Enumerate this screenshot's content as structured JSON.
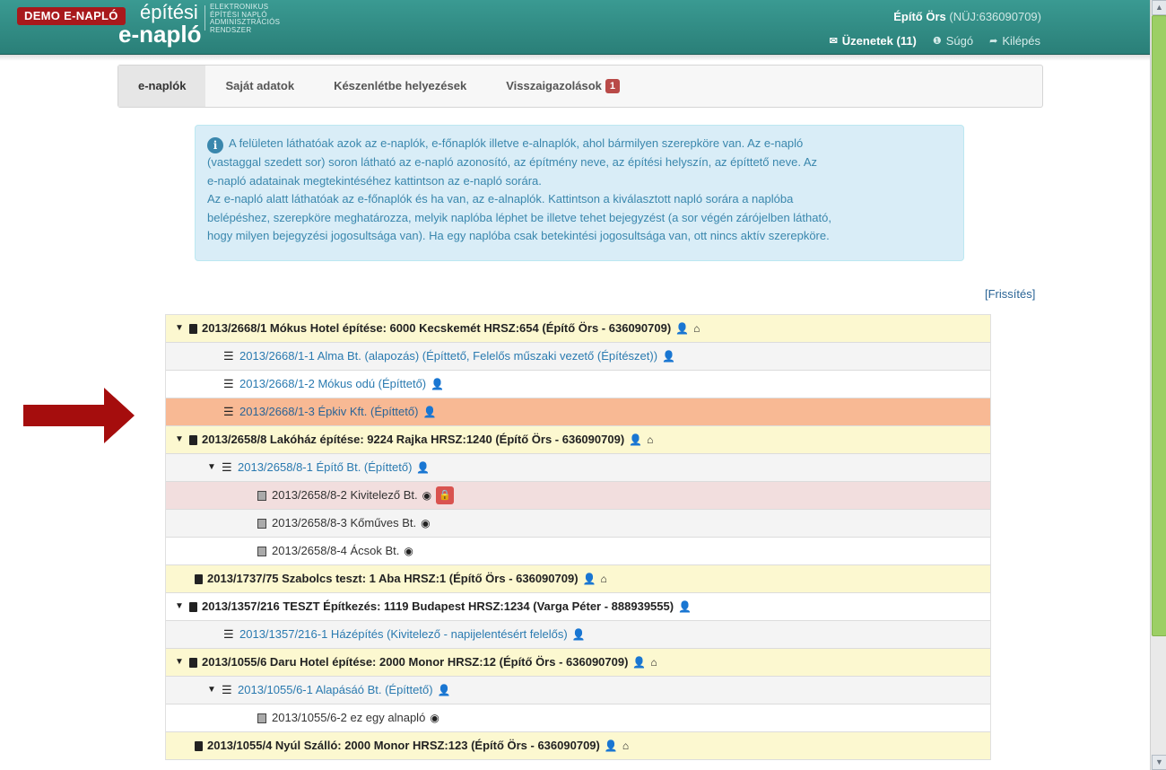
{
  "header": {
    "demo_badge": "DEMO E-NAPLÓ",
    "logo_line1": "építési",
    "logo_line2": "e-napló",
    "logo_small": [
      "ELEKTRONIKUS",
      "ÉPÍTÉSI NAPLÓ",
      "ADMINISZTRÁCIÓS",
      "RENDSZER"
    ],
    "user_name": "Építő Örs",
    "user_id": "(NÜJ:636090709)",
    "messages": "Üzenetek (11)",
    "help": "Súgó",
    "logout": "Kilépés"
  },
  "tabs": [
    {
      "label": "e-naplók"
    },
    {
      "label": "Saját adatok"
    },
    {
      "label": "Készenlétbe helyezések"
    },
    {
      "label": "Visszaigazolások",
      "badge": "1"
    }
  ],
  "info_lines": [
    "A felületen láthatóak azok az e-naplók, e-főnaplók illetve e-alnaplók, ahol bármilyen szerepköre van. Az e-napló",
    "(vastaggal szedett sor) soron látható az e-napló azonosító, az építmény neve, az építési helyszín, az építtető neve. Az",
    "e-napló adatainak megtekintéséhez kattintson az e-napló sorára.",
    "Az e-napló alatt láthatóak az e-főnaplók és ha van, az e-alnaplók. Kattintson a kiválasztott napló sorára a naplóba",
    "belépéshez, szerepköre meghatározza, melyik naplóba léphet be illetve tehet bejegyzést (a sor végén zárójelben látható,",
    "hogy milyen bejegyzési jogosultsága van). Ha egy naplóba csak betekintési jogosultsága van, ott nincs aktív szerepköre."
  ],
  "refresh": "[Frissítés]",
  "rows": [
    {
      "text": "2013/2668/1 Mókus Hotel építése: 6000 Kecskemét HRSZ:654 (Építő Örs - 636090709)"
    },
    {
      "text": "2013/2668/1-1 Alma Bt. (alapozás) (Építtető, Felelős műszaki vezető (Építészet))"
    },
    {
      "text": "2013/2668/1-2 Mókus odú (Építtető)"
    },
    {
      "text": "2013/2668/1-3 Épkiv Kft. (Építtető)"
    },
    {
      "text": "2013/2658/8 Lakóház építése: 9224 Rajka HRSZ:1240 (Építő Örs - 636090709)"
    },
    {
      "text": "2013/2658/8-1 Építő Bt. (Építtető)"
    },
    {
      "text": "2013/2658/8-2 Kivitelező Bt."
    },
    {
      "text": "2013/2658/8-3 Kőműves Bt."
    },
    {
      "text": "2013/2658/8-4 Ácsok Bt."
    },
    {
      "text": "2013/1737/75 Szabolcs teszt: 1 Aba HRSZ:1 (Építő Örs - 636090709)"
    },
    {
      "text": "2013/1357/216 TESZT Építkezés: 1119 Budapest HRSZ:1234 (Varga Péter - 888939555)"
    },
    {
      "text": "2013/1357/216-1 Házépítés (Kivitelező - napijelentésért felelős)"
    },
    {
      "text": "2013/1055/6 Daru Hotel építése: 2000 Monor HRSZ:12 (Építő Örs - 636090709)"
    },
    {
      "text": "2013/1055/6-1 Alapásáó Bt. (Építtető)"
    },
    {
      "text": "2013/1055/6-2 ez egy alnapló"
    },
    {
      "text": "2013/1055/4 Nyúl Szálló: 2000 Monor HRSZ:123 (Építő Örs - 636090709)"
    }
  ]
}
